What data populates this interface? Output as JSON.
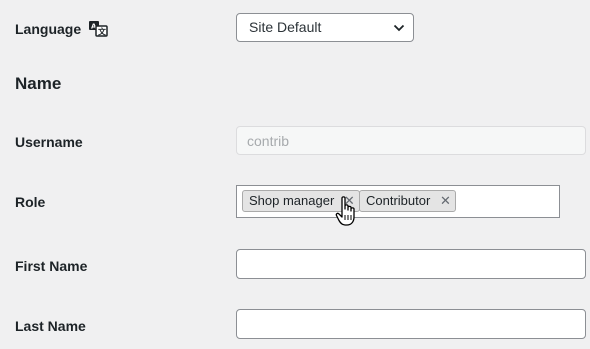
{
  "language": {
    "label": "Language",
    "icon": "translate-icon",
    "select_value": "Site Default"
  },
  "name_section": {
    "title": "Name"
  },
  "username": {
    "label": "Username",
    "value": "contrib"
  },
  "role": {
    "label": "Role",
    "tags": [
      {
        "text": "Shop manager",
        "remove": "✕"
      },
      {
        "text": "Contributor",
        "remove": "✕"
      }
    ]
  },
  "first_name": {
    "label": "First Name",
    "value": ""
  },
  "last_name": {
    "label": "Last Name",
    "value": ""
  }
}
